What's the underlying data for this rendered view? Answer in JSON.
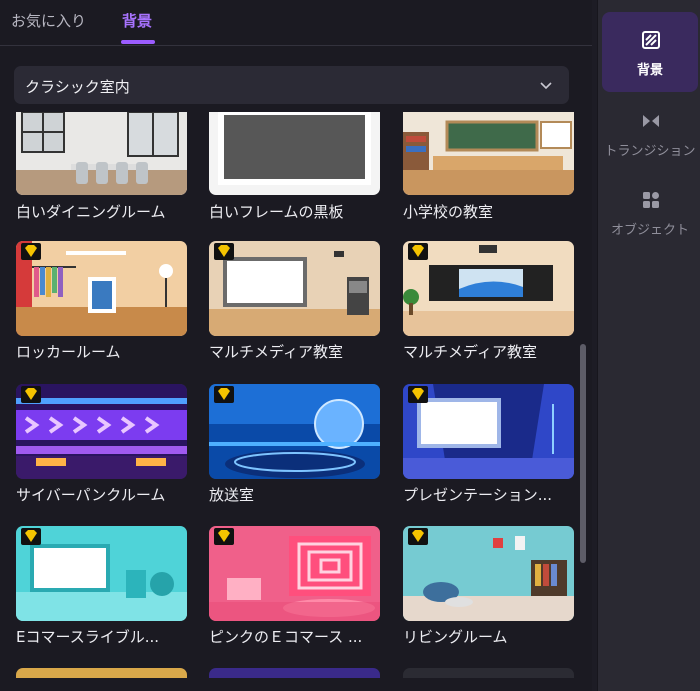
{
  "tabs": [
    {
      "label": "お気に入り",
      "active": false
    },
    {
      "label": "背景",
      "active": true
    }
  ],
  "dropdown": {
    "label": "クラシック室内",
    "icon": "chevron-down-icon"
  },
  "cards": [
    {
      "title": "白いダイニングルーム",
      "premium": true
    },
    {
      "title": "白いフレームの黒板",
      "premium": false
    },
    {
      "title": "小学校の教室",
      "premium": true
    },
    {
      "title": "ロッカールーム",
      "premium": true
    },
    {
      "title": "マルチメディア教室",
      "premium": true
    },
    {
      "title": "マルチメディア教室",
      "premium": true
    },
    {
      "title": "サイバーパンクルーム",
      "premium": true
    },
    {
      "title": "放送室",
      "premium": true
    },
    {
      "title": "プレゼンテーション...",
      "premium": true
    },
    {
      "title": "Eコマースライブル...",
      "premium": true
    },
    {
      "title": "ピンクのＥコマース ...",
      "premium": true
    },
    {
      "title": "リビングルーム",
      "premium": true
    }
  ],
  "sidebar": [
    {
      "label": "背景",
      "icon": "background-icon",
      "active": true
    },
    {
      "label": "トランジション",
      "icon": "transition-icon",
      "active": false
    },
    {
      "label": "オブジェクト",
      "icon": "object-icon",
      "active": false
    }
  ],
  "colors": {
    "accent": "#9b5cff",
    "premium_badge": "#f5c400",
    "panel_bg": "#1b1a22",
    "sidebar_bg": "#2a2932"
  }
}
